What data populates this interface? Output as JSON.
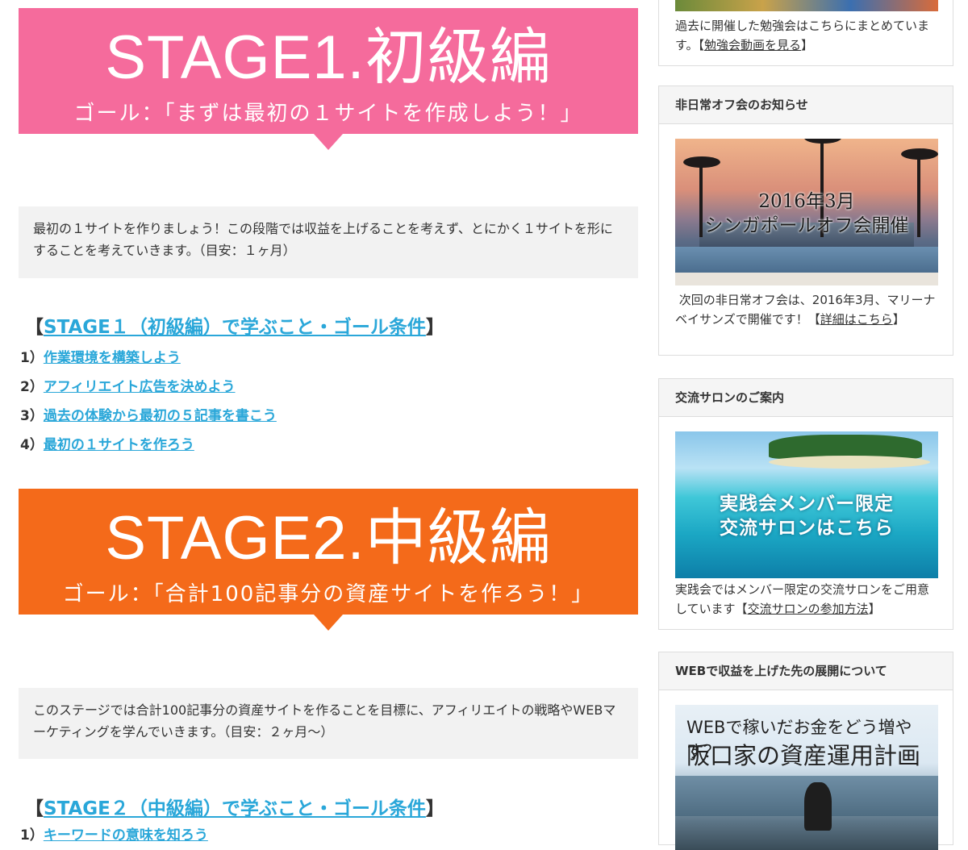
{
  "main": {
    "stage1": {
      "banner_title": "STAGE1.初級編",
      "banner_goal": "ゴール：「まずは最初の１サイトを作成しよう！」",
      "description": "最初の１サイトを作りましょう！この段階では収益を上げることを考えず、とにかく１サイトを形にすることを考えていきます。（目安：１ヶ月）",
      "heading_open": "【",
      "heading_link": "STAGE１（初級編）で学ぶこと・ゴール条件",
      "heading_close": "】",
      "items": [
        {
          "num": "1）",
          "label": "作業環境を構築しよう"
        },
        {
          "num": "2）",
          "label": "アフィリエイト広告を決めよう"
        },
        {
          "num": "3）",
          "label": "過去の体験から最初の５記事を書こう"
        },
        {
          "num": "4）",
          "label": "最初の１サイトを作ろう"
        }
      ]
    },
    "stage2": {
      "banner_title": "STAGE2.中級編",
      "banner_goal": "ゴール：「合計100記事分の資産サイトを作ろう！」",
      "description": "このステージでは合計100記事分の資産サイトを作ることを目標に、アフィリエイトの戦略やWEBマーケティングを学んでいきます。（目安：２ヶ月〜）",
      "heading_open": "【",
      "heading_link": "STAGE２（中級編）で学ぶこと・ゴール条件",
      "heading_close": "】",
      "items": [
        {
          "num": "1）",
          "label": "キーワードの意味を知ろう"
        }
      ]
    }
  },
  "sidebar": {
    "study": {
      "text_before": "過去に開催した勉強会はこちらにまとめています。【",
      "link": "勉強会動画を見る",
      "text_after": "】"
    },
    "offkai": {
      "title": "非日常オフ会のお知らせ",
      "image_line1": "2016年3月",
      "image_line2": "シンガポールオフ会開催",
      "text_before": "次回の非日常オフ会は、2016年3月、マリーナベイサンズで開催です！【",
      "link": "詳細はこちら",
      "text_after": "】"
    },
    "salon": {
      "title": "交流サロンのご案内",
      "image_line1": "実践会メンバー限定",
      "image_line2": "交流サロンはこちら",
      "text_before": "実践会ではメンバー限定の交流サロンをご用意しています【",
      "link": "交流サロンの参加方法",
      "text_after": "】"
    },
    "web": {
      "title": "WEBで収益を上げた先の展開について",
      "image_line1": "WEBで稼いだお金をどう増やす？",
      "image_line2": "阪口家の資産運用計画"
    }
  },
  "colors": {
    "stage1_pink": "#f56b9c",
    "stage2_orange": "#f46a1a",
    "link_blue": "#2aa7d9"
  }
}
